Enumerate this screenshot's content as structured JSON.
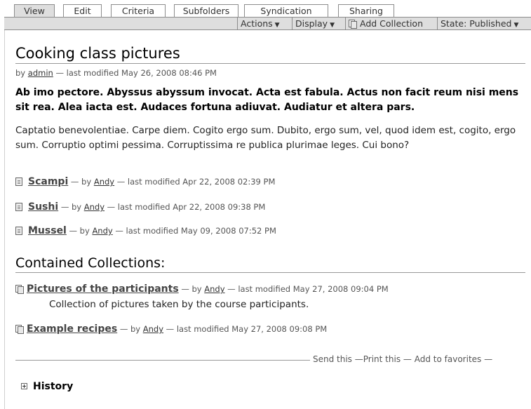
{
  "tabs": [
    "View",
    "Edit",
    "Criteria",
    "Subfolders",
    "Syndication",
    "Sharing"
  ],
  "selected_tab": "View",
  "actions": {
    "actions_label": "Actions",
    "display_label": "Display",
    "add_collection_label": "Add Collection",
    "state_label": "State: Published"
  },
  "page": {
    "title": "Cooking class pictures",
    "by": "by",
    "author": "admin",
    "modified": "— last modified May 26, 2008 08:46 PM",
    "description": "Ab imo pectore. Abyssus abyssum invocat. Acta est fabula. Actus non facit reum nisi mens sit rea. Alea iacta est. Audaces fortuna adiuvat. Audiatur et altera pars.",
    "body": "Captatio benevolentiae. Carpe diem. Cogito ergo sum. Dubito, ergo sum, vel, quod idem est, cogito, ergo sum. Corruptio optimi pessima. Corruptissima re publica plurimae leges. Cui bono?"
  },
  "items": [
    {
      "title": "Scampi",
      "by": "— by",
      "author": "Andy",
      "modified": "— last modified Apr 22, 2008 02:39 PM"
    },
    {
      "title": "Sushi",
      "by": "— by",
      "author": "Andy",
      "modified": "— last modified Apr 22, 2008 09:38 PM"
    },
    {
      "title": "Mussel",
      "by": "— by",
      "author": "Andy",
      "modified": "— last modified May 09, 2008 07:52 PM"
    }
  ],
  "collections": {
    "heading": "Contained Collections:",
    "items": [
      {
        "title": "Pictures of the participants",
        "by": "— by",
        "author": "Andy",
        "modified": "— last modified May 27, 2008 09:04 PM",
        "description": "Collection of pictures taken by the course participants."
      },
      {
        "title": "Example recipes",
        "by": "— by",
        "author": "Andy",
        "modified": "— last modified May 27, 2008 09:08 PM"
      }
    ]
  },
  "footer": {
    "send": "Send this",
    "print": "Print this",
    "favorites": "Add to favorites",
    "dash": "—"
  },
  "history": {
    "label": "History"
  },
  "icons": {
    "document": "document-icon",
    "collection": "collection-icon",
    "expand": "plus-box-icon",
    "dropdown": "caret-down-icon"
  }
}
